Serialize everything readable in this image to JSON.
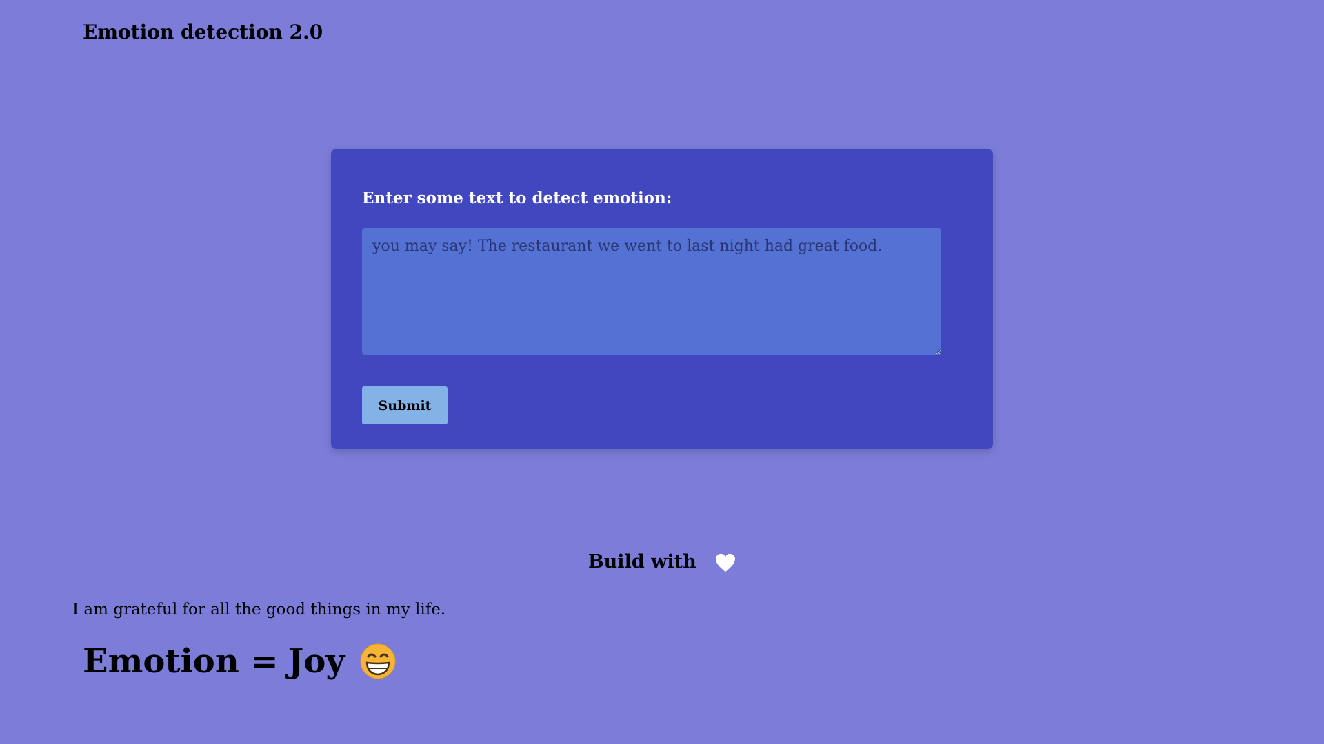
{
  "app": {
    "title": "Emotion detection 2.0"
  },
  "form": {
    "label": "Enter some text to detect emotion:",
    "input_value": "you may say! The restaurant we went to last night had great food.",
    "submit_label": "Submit"
  },
  "footer": {
    "text": "Build with",
    "icon": "heart-icon"
  },
  "result": {
    "sentence": "I am grateful for all the good things in my life.",
    "prefix": "Emotion =",
    "emotion": "Joy",
    "emoji": "grinning-face-icon"
  },
  "colors": {
    "background": "#7c7dd9",
    "card": "#4047bf",
    "input": "#5472d4",
    "button": "#83b2e6"
  }
}
